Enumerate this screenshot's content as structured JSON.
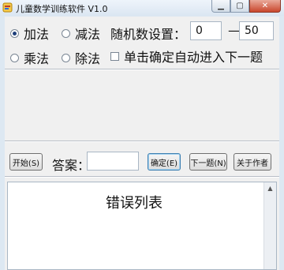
{
  "window": {
    "title": "儿童数学训练软件 V1.0"
  },
  "ops": {
    "add": "加法",
    "sub": "减法",
    "mul": "乘法",
    "div": "除法"
  },
  "range": {
    "label": "随机数设置：",
    "min": "0",
    "dash": "—",
    "max": "50"
  },
  "auto": {
    "label": "单击确定自动进入下一题"
  },
  "controls": {
    "start": "开始(S)",
    "answer_label": "答案：",
    "answer_value": "",
    "confirm": "确定(E)",
    "next": "下一题(N)",
    "about": "关于作者"
  },
  "errors": {
    "title": "错误列表"
  }
}
